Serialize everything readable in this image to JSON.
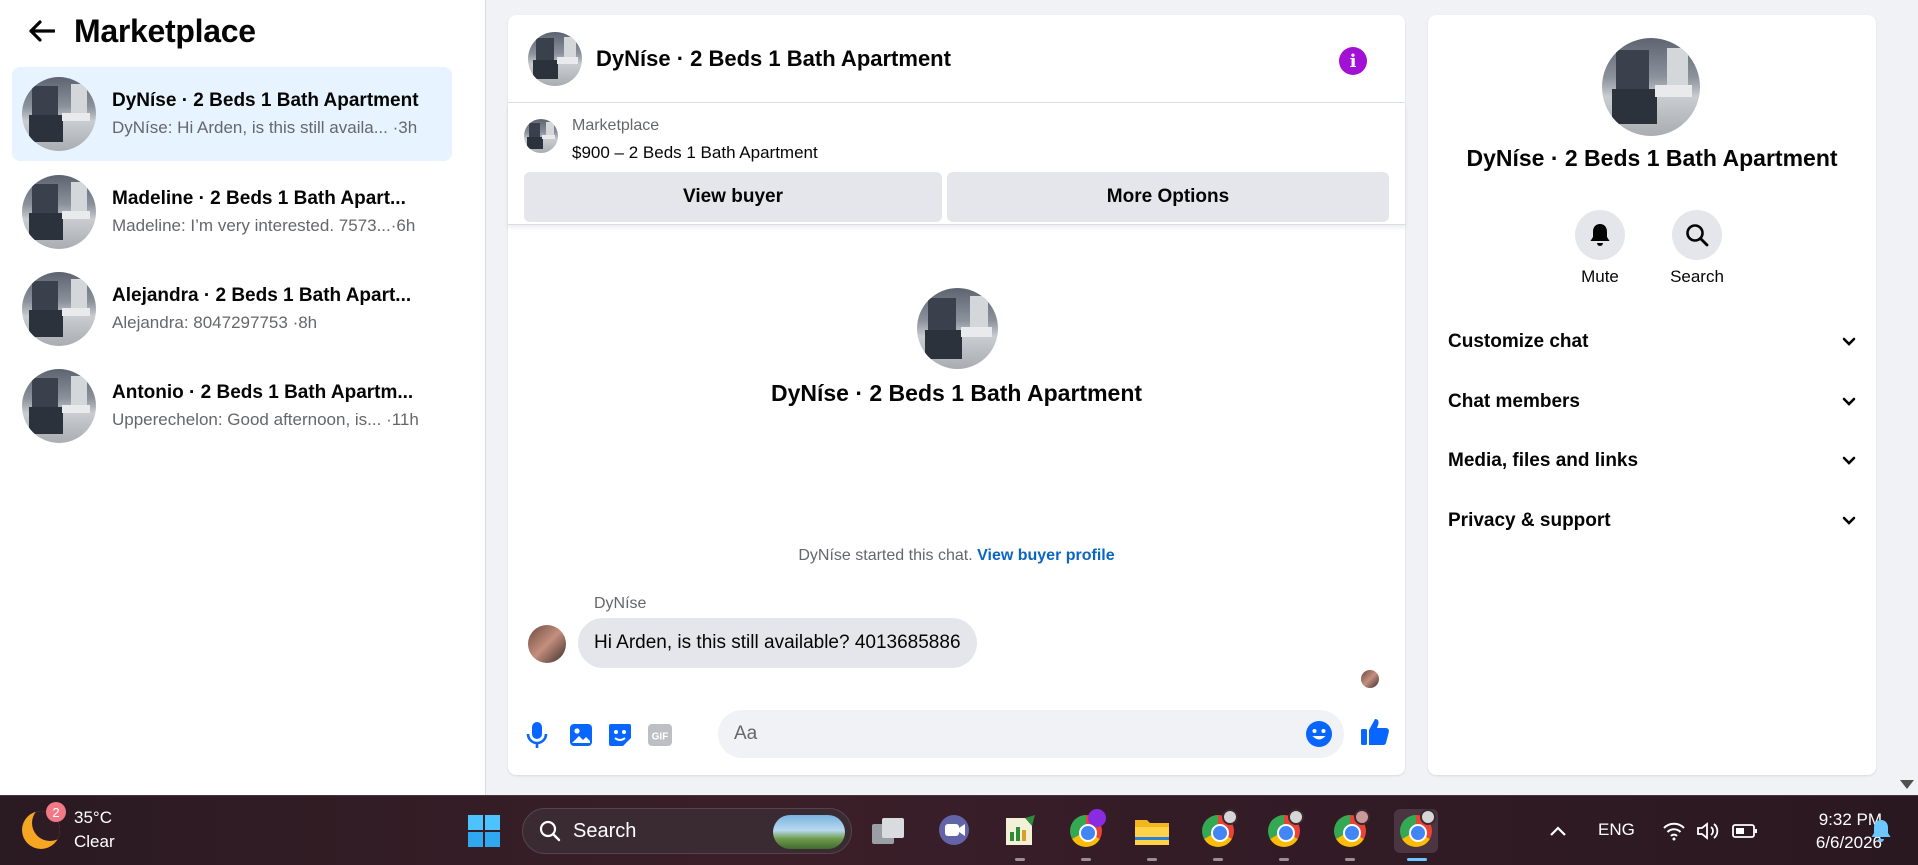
{
  "sidebar": {
    "title": "Marketplace",
    "conversations": [
      {
        "name": "DyNíse · 2 Beds 1 Bath Apartment",
        "preview": "DyNíse: Hi Arden, is this still availa...",
        "time": "·3h"
      },
      {
        "name": "Madeline · 2 Beds 1 Bath Apart...",
        "preview": "Madeline: I’m very interested. 7573...",
        "time": "·6h"
      },
      {
        "name": "Alejandra · 2 Beds 1 Bath Apart...",
        "preview": "Alejandra: 8047297753",
        "time": "·8h"
      },
      {
        "name": "Antonio · 2 Beds 1 Bath Apartm...",
        "preview": "Upperechelon: Good afternoon, is...",
        "time": "·11h"
      }
    ]
  },
  "chat": {
    "title": "DyNíse · 2 Beds 1 Bath Apartment",
    "marketplace_label": "Marketplace",
    "listing": "$900 – 2 Beds 1 Bath Apartment",
    "view_buyer": "View buyer",
    "more_options": "More Options",
    "center_name": "DyNíse · 2 Beds 1 Bath Apartment",
    "started_text": "DyNíse started this chat.",
    "view_profile": "View buyer profile",
    "sender": "DyNíse",
    "message": "Hi Arden, is this still available? 4013685886",
    "input_placeholder": "Aa"
  },
  "panel": {
    "name": "DyNíse · 2 Beds 1 Bath Apartment",
    "mute": "Mute",
    "search": "Search",
    "sections": [
      "Customize chat",
      "Chat members",
      "Media, files and links",
      "Privacy & support"
    ]
  },
  "taskbar": {
    "weather_badge": "2",
    "temperature": "35°C",
    "condition": "Clear",
    "search": "Search",
    "language": "ENG",
    "time": "9:32 PM",
    "date": "6/6/2026",
    "apps": [
      "windows-start",
      "search",
      "task-view",
      "teams",
      "excel",
      "chrome",
      "file-explorer",
      "chrome",
      "chrome",
      "chrome",
      "chrome"
    ]
  },
  "colors": {
    "accent": "#0a66c2",
    "info": "#a210d6",
    "active_conv": "#e7f3ff"
  }
}
